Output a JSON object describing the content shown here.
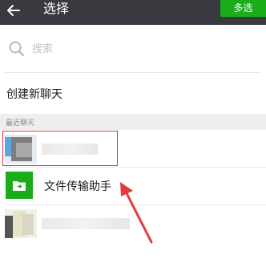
{
  "header": {
    "title": "选择",
    "multi_select_label": "多选",
    "background_color": "#393a3f",
    "accent_color": "#1aad19"
  },
  "search": {
    "placeholder": "搜索"
  },
  "create_chat_label": "创建新聊天",
  "recent_section": {
    "label": "最近聊天",
    "items": [
      {
        "icon": "blurred-avatar",
        "name_visible": false,
        "highlighted": true
      },
      {
        "icon": "folder-icon",
        "name": "文件传输助手"
      },
      {
        "icon": "blurred-avatar",
        "name_visible": false
      }
    ]
  },
  "annotation": {
    "highlight_color": "#e23b3b",
    "arrow_color": "#e23b3b"
  }
}
